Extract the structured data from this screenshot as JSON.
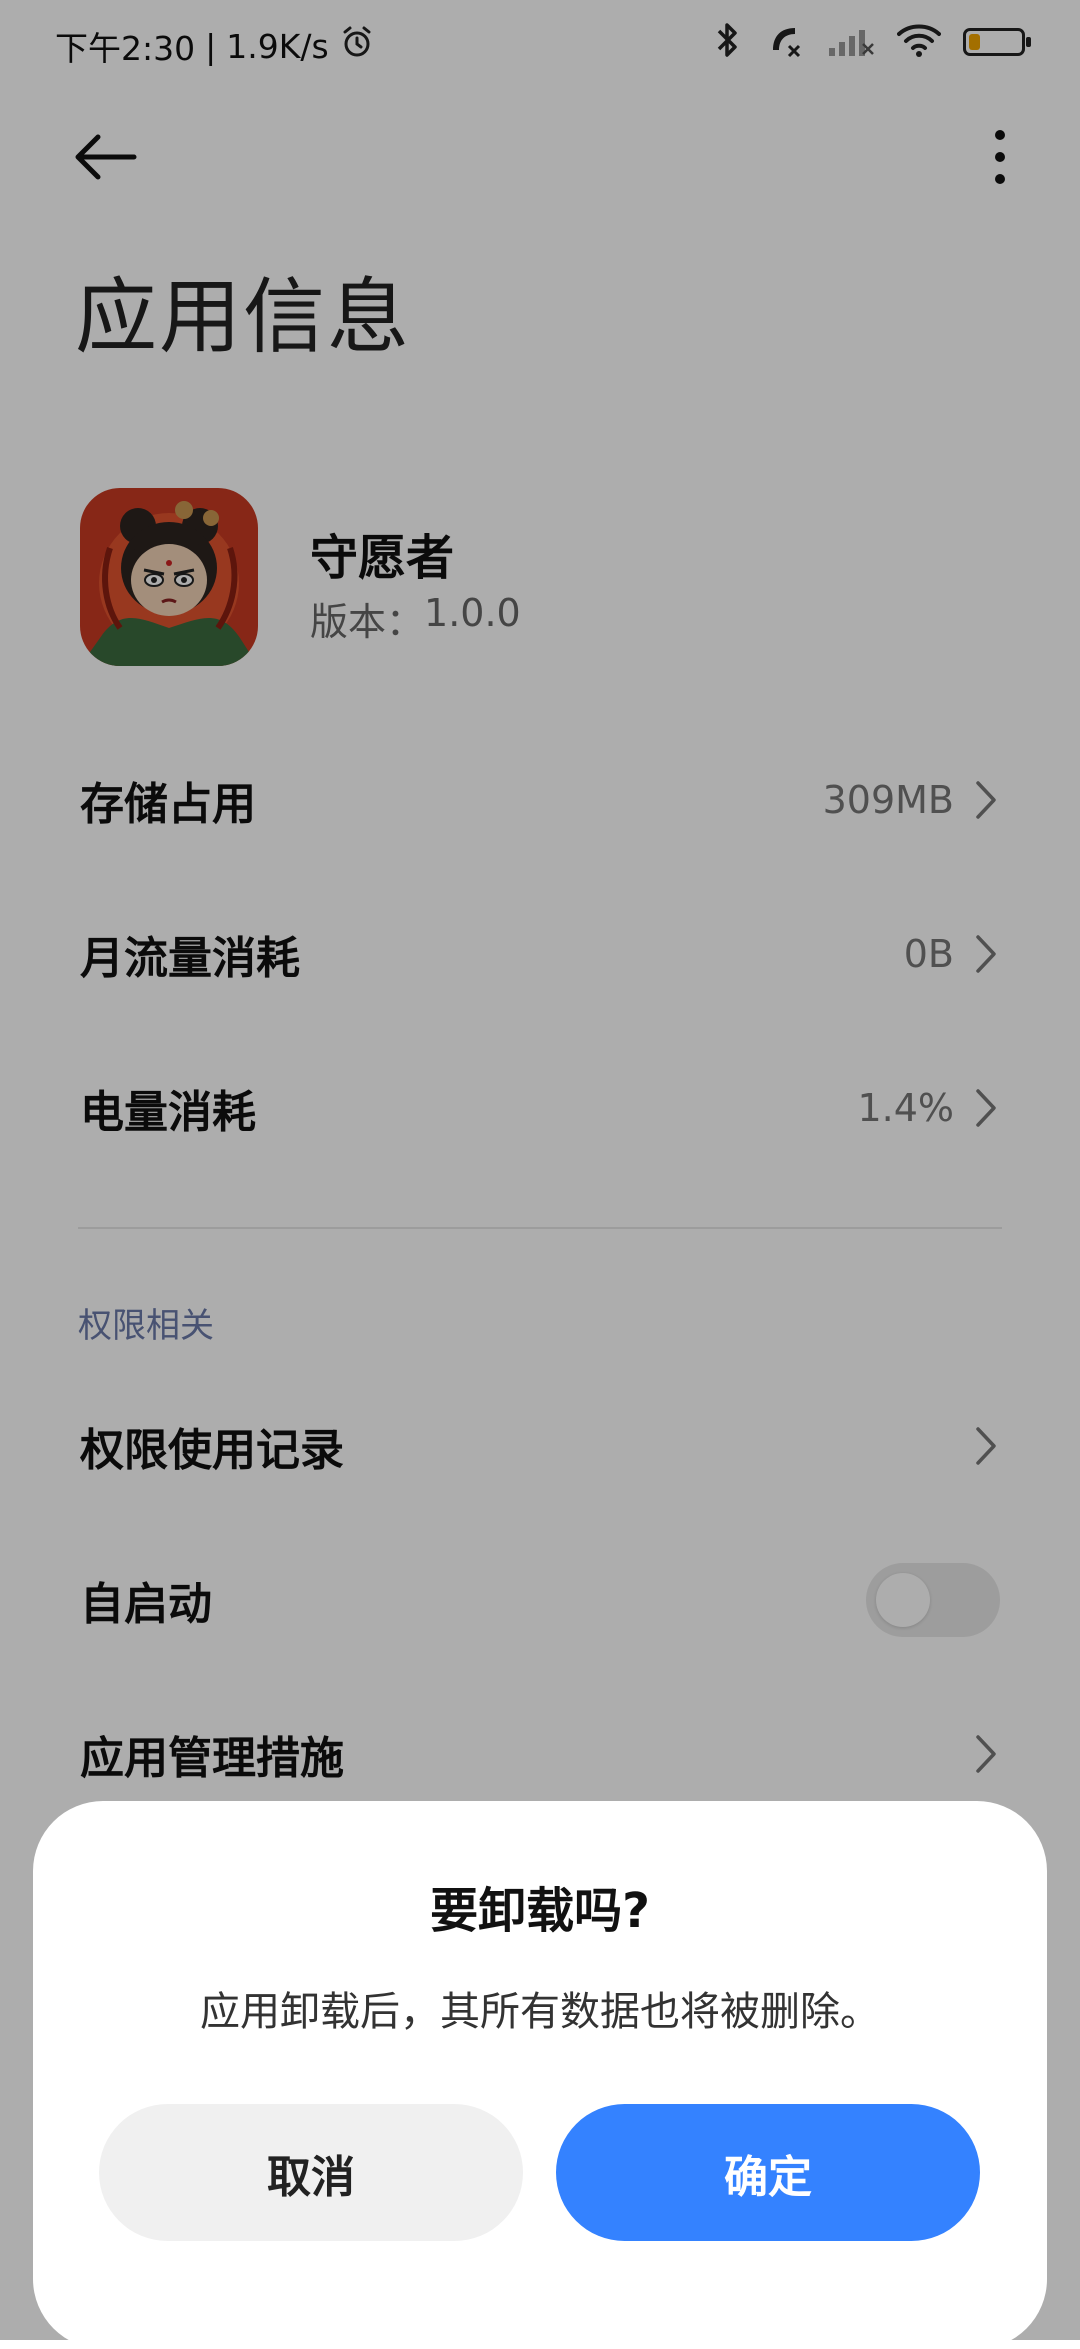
{
  "status_bar": {
    "time": "下午2:30",
    "separator": "|",
    "network_speed": "1.9K/s",
    "battery_level": 0.22,
    "battery_color": "#f0a400"
  },
  "page": {
    "title": "应用信息"
  },
  "app": {
    "name": "守愿者",
    "version_label": "版本：",
    "version": "1.0.0"
  },
  "rows": [
    {
      "label": "存储占用",
      "value": "309MB"
    },
    {
      "label": "月流量消耗",
      "value": "0B"
    },
    {
      "label": "电量消耗",
      "value": "1.4%"
    }
  ],
  "permissions": {
    "section_title": "权限相关",
    "items": [
      {
        "label": "权限使用记录",
        "type": "chevron"
      },
      {
        "label": "自启动",
        "type": "toggle",
        "on": false
      },
      {
        "label": "应用管理措施",
        "type": "chevron"
      }
    ]
  },
  "dialog": {
    "title": "要卸载吗?",
    "message": "应用卸载后，其所有数据也将被删除。",
    "cancel_label": "取消",
    "confirm_label": "确定",
    "confirm_color": "#3482ff"
  }
}
